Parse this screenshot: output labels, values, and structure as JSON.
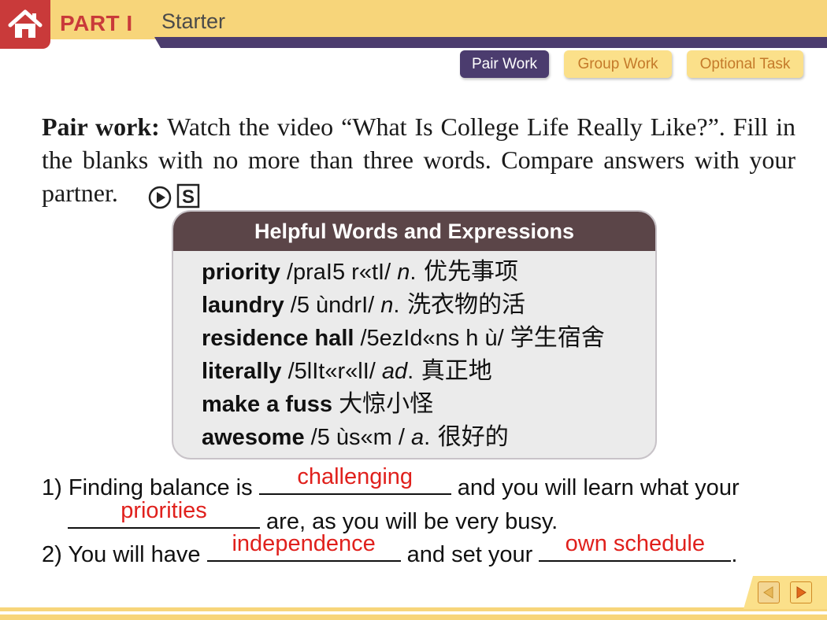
{
  "header": {
    "part": "PART I",
    "title": "Starter"
  },
  "tabs": [
    {
      "label": "Pair Work",
      "active": true
    },
    {
      "label": "Group Work",
      "active": false
    },
    {
      "label": "Optional Task",
      "active": false
    }
  ],
  "instructions": {
    "lead": "Pair work:",
    "text": "Watch the video “What Is College Life Really Like?”. Fill in the blanks with no more than three words. Compare answers with your partner."
  },
  "media_icons": [
    "play-icon",
    "script-icon"
  ],
  "helpful": {
    "title": "Helpful Words and Expressions",
    "items": [
      {
        "term": "priority",
        "phonetic": " /praI5 r«tI/ ",
        "pos": "n",
        "cn": " 优先事项"
      },
      {
        "term": "laundry",
        "phonetic": " /5 ùndrI/ ",
        "pos": "n",
        "cn": " 洗衣物的活"
      },
      {
        "term": "residence hall",
        "phonetic": " /5ezId«ns h ù/ ",
        "pos": "",
        "cn": "学生宿舍"
      },
      {
        "term": "literally",
        "phonetic": " /5lIt«r«lI/ ",
        "pos": "ad",
        "cn": " 真正地"
      },
      {
        "term": "make a fuss",
        "phonetic": " ",
        "pos": "",
        "cn": "大惊小怪"
      },
      {
        "term": "awesome",
        "phonetic": " /5 ùs«m / ",
        "pos": "a",
        "cn": " 很好的"
      }
    ]
  },
  "exercise": {
    "q1_num": "1)",
    "q1_a": "Finding balance is ",
    "q1_ans1": "challenging",
    "q1_b": " and you will learn what your",
    "q1_ans2": "priorities",
    "q1_c": " are, as you will be very busy.",
    "q2_num": "2)",
    "q2_a": "You will have ",
    "q2_ans1": "independence",
    "q2_b": " and set your ",
    "q2_ans2": "own schedule",
    "q2_c": "."
  },
  "colors": {
    "accent_red": "#c93a3a",
    "header_yellow": "#f7d57a",
    "purple": "#4b3c6e",
    "answer_red": "#e0201c"
  }
}
